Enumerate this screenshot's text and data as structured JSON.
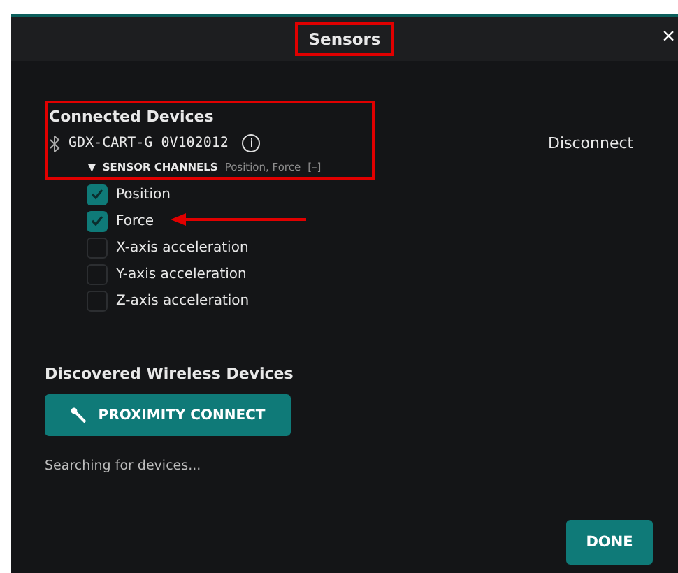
{
  "dialog": {
    "title": "Sensors",
    "title_highlighted": true,
    "close": "×"
  },
  "connected": {
    "heading": "Connected Devices",
    "highlighted": true,
    "device": {
      "name": "GDX-CART-G 0V102012",
      "info": "i",
      "action": "Disconnect"
    },
    "channels_header": {
      "expanded": true,
      "marker": "▼",
      "label": "SENSOR CHANNELS",
      "summary": "Position, Force",
      "toggle": "[–]"
    },
    "channels": [
      {
        "label": "Position",
        "checked": true,
        "arrow": false
      },
      {
        "label": "Force",
        "checked": true,
        "arrow": true
      },
      {
        "label": "X-axis acceleration",
        "checked": false,
        "arrow": false
      },
      {
        "label": "Y-axis acceleration",
        "checked": false,
        "arrow": false
      },
      {
        "label": "Z-axis acceleration",
        "checked": false,
        "arrow": false
      }
    ]
  },
  "discovered": {
    "heading": "Discovered Wireless Devices",
    "button": "PROXIMITY CONNECT",
    "status": "Searching for devices..."
  },
  "footer": {
    "button": "DONE"
  }
}
